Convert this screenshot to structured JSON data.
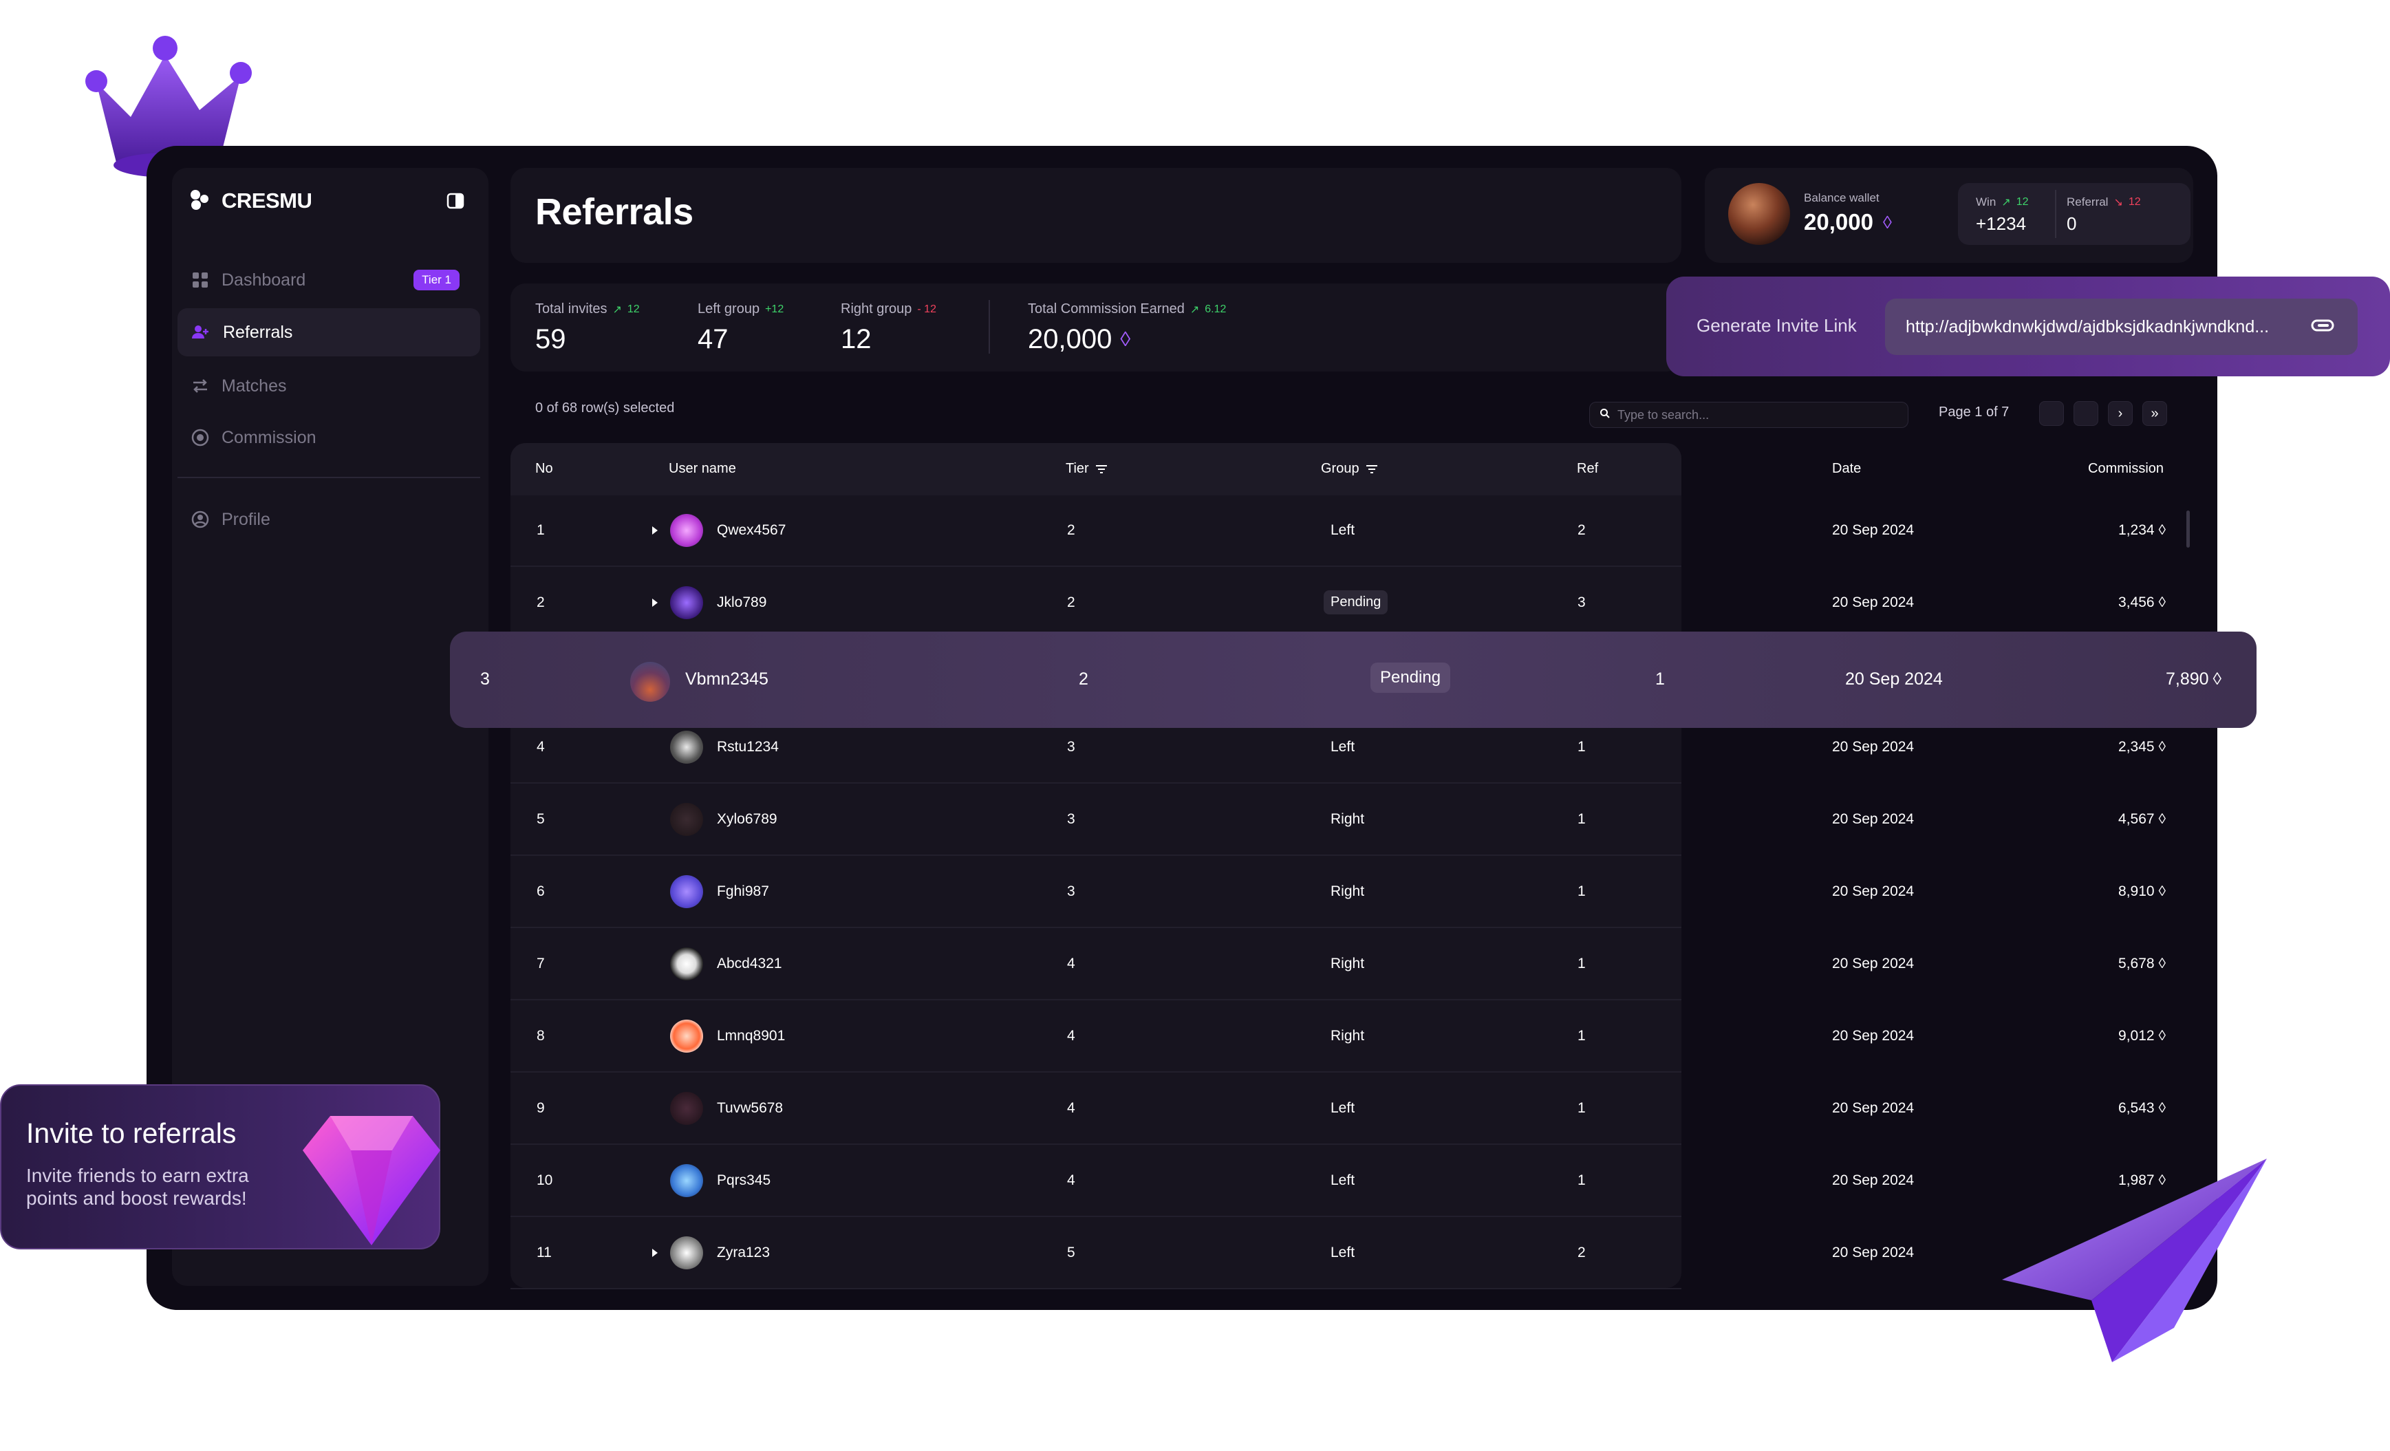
{
  "brand": {
    "name": "CRESMU"
  },
  "sidebar": {
    "items": [
      {
        "label": "Dashboard",
        "badge": "Tier 1"
      },
      {
        "label": "Referrals"
      },
      {
        "label": "Matches"
      },
      {
        "label": "Commission"
      },
      {
        "label": "Profile"
      }
    ]
  },
  "header": {
    "title": "Referrals"
  },
  "wallet": {
    "label": "Balance wallet",
    "balance": "20,000",
    "win_label": "Win",
    "win_delta": "12",
    "win_value": "+1234",
    "referral_label": "Referral",
    "referral_delta": "12",
    "referral_value": "0"
  },
  "stats": {
    "total_invites_label": "Total invites",
    "total_invites_delta": "12",
    "total_invites_value": "59",
    "left_group_label": "Left group",
    "left_group_delta": "+12",
    "left_group_value": "47",
    "right_group_label": "Right group",
    "right_group_delta": "- 12",
    "right_group_value": "12",
    "commission_label": "Total Commission Earned",
    "commission_delta": "6.12",
    "commission_value": "20,000"
  },
  "invite_link": {
    "label": "Generate Invite Link",
    "url": "http://adjbwkdnwkjdwd/ajdbksjdkadnkjwndknd..."
  },
  "table_controls": {
    "selected_text": "0 of 68 row(s) selected",
    "search_placeholder": "Type to search...",
    "page_text": "Page 1 of 7"
  },
  "table": {
    "columns": [
      "No",
      "User name",
      "Tier",
      "Group",
      "Ref",
      "Date",
      "Commission"
    ],
    "rows": [
      {
        "no": "1",
        "user": "Qwex4567",
        "tier": "2",
        "group": "Left",
        "ref": "2",
        "date": "20 Sep 2024",
        "commission": "1,234"
      },
      {
        "no": "2",
        "user": "Jklo789",
        "tier": "2",
        "group": "Pending",
        "ref": "3",
        "date": "20 Sep 2024",
        "commission": "3,456"
      },
      {
        "no": "3",
        "user": "Vbmn2345",
        "tier": "2",
        "group": "Pending",
        "ref": "1",
        "date": "20 Sep 2024",
        "commission": "7,890"
      },
      {
        "no": "4",
        "user": "Rstu1234",
        "tier": "3",
        "group": "Left",
        "ref": "1",
        "date": "20 Sep 2024",
        "commission": "2,345"
      },
      {
        "no": "5",
        "user": "Xylo6789",
        "tier": "3",
        "group": "Right",
        "ref": "1",
        "date": "20 Sep 2024",
        "commission": "4,567"
      },
      {
        "no": "6",
        "user": "Fghi987",
        "tier": "3",
        "group": "Right",
        "ref": "1",
        "date": "20 Sep 2024",
        "commission": "8,910"
      },
      {
        "no": "7",
        "user": "Abcd4321",
        "tier": "4",
        "group": "Right",
        "ref": "1",
        "date": "20 Sep 2024",
        "commission": "5,678"
      },
      {
        "no": "8",
        "user": "Lmnq8901",
        "tier": "4",
        "group": "Right",
        "ref": "1",
        "date": "20 Sep 2024",
        "commission": "9,012"
      },
      {
        "no": "9",
        "user": "Tuvw5678",
        "tier": "4",
        "group": "Left",
        "ref": "1",
        "date": "20 Sep 2024",
        "commission": "6,543"
      },
      {
        "no": "10",
        "user": "Pqrs345",
        "tier": "4",
        "group": "Left",
        "ref": "1",
        "date": "20 Sep 2024",
        "commission": "1,987"
      },
      {
        "no": "11",
        "user": "Zyra123",
        "tier": "5",
        "group": "Left",
        "ref": "2",
        "date": "20 Sep 2024",
        "commission": ""
      }
    ]
  },
  "promo": {
    "title": "Invite to referrals",
    "text": "Invite friends to earn extra points and boost rewards!"
  },
  "colors": {
    "accent": "#8a38f5",
    "up": "#3ed36a",
    "down": "#f0425c",
    "background": "#0e0b16"
  }
}
